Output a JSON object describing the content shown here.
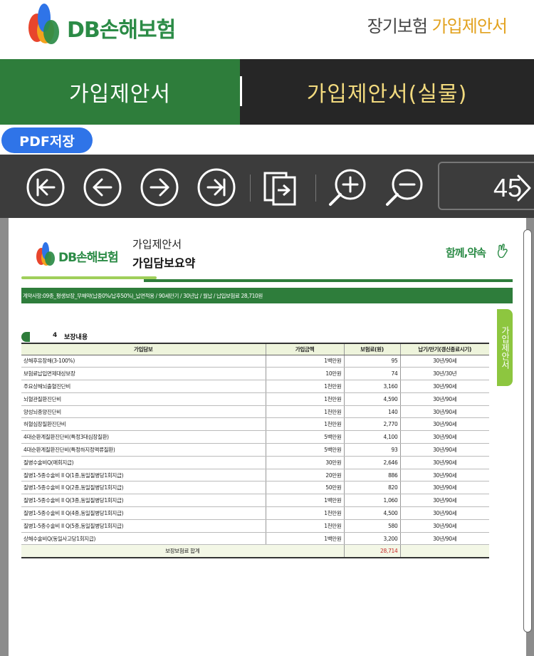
{
  "header": {
    "logo_text": "DB손해보험",
    "title_prefix": "장기보험",
    "title_accent": "가입제안서",
    "brand_green": "#2b8b46",
    "accent_color": "#e2a21f"
  },
  "tabs": [
    {
      "label": "가입제안서",
      "active": true
    },
    {
      "label": "가입제안서(실물)",
      "active": false
    }
  ],
  "pdf_button": {
    "label": "PDF저장"
  },
  "toolbar": {
    "icons": [
      "first-page-icon",
      "prev-page-icon",
      "next-page-icon",
      "last-page-icon",
      "page-view-icon",
      "zoom-in-icon",
      "zoom-out-icon"
    ],
    "page_number": "45"
  },
  "document": {
    "logo_text": "DB손해보험",
    "title1": "가입제안서",
    "title2": "가입담보요약",
    "slogan": "함께,약속",
    "info_bar": "계약사항:09종_평생보장_무해약(납중0%/납후50%)_납면적용 / 90세만기 / 30년납 / 월납 / 납입보험료 28,710원",
    "side_tab": "가입제안서",
    "section_num": "4",
    "section_title": "보장내용",
    "table": {
      "headers": [
        "가입담보",
        "가입금액",
        "보험료(원)",
        "납기/만기(갱신종료시기)"
      ],
      "rows": [
        {
          "name": "상해후유장해(3-100%)",
          "amount": "1백만원",
          "premium": "95",
          "term": "30년/90세"
        },
        {
          "name": "보험료납입면제대상보장",
          "amount": "10만원",
          "premium": "74",
          "term": "30년/30년"
        },
        {
          "name": "주요상해뇌출혈진단비",
          "amount": "1천만원",
          "premium": "3,160",
          "term": "30년/90세"
        },
        {
          "name": "뇌혈관질환진단비",
          "amount": "1천만원",
          "premium": "4,590",
          "term": "30년/90세"
        },
        {
          "name": "양성뇌종양진단비",
          "amount": "1천만원",
          "premium": "140",
          "term": "30년/90세"
        },
        {
          "name": "허혈심장질환진단비",
          "amount": "1천만원",
          "premium": "2,770",
          "term": "30년/90세"
        },
        {
          "name": "4대순환계질환진단비(특정3대심장질환)",
          "amount": "5백만원",
          "premium": "4,100",
          "term": "30년/90세"
        },
        {
          "name": "4대순환계질환진단비(특정하지정맥류질환)",
          "amount": "5백만원",
          "premium": "93",
          "term": "30년/90세"
        },
        {
          "name": "질병수술비Q(매회지급)",
          "amount": "30만원",
          "premium": "2,646",
          "term": "30년/90세"
        },
        {
          "name": "질병1-5종수술비 II Q(1종,동일질병당1회지급)",
          "amount": "20만원",
          "premium": "886",
          "term": "30년/90세"
        },
        {
          "name": "질병1-5종수술비 II Q(2종,동일질병당1회지급)",
          "amount": "50만원",
          "premium": "820",
          "term": "30년/90세"
        },
        {
          "name": "질병1-5종수술비 II Q(3종,동일질병당1회지급)",
          "amount": "1백만원",
          "premium": "1,060",
          "term": "30년/90세"
        },
        {
          "name": "질병1-5종수술비 II Q(4종,동일질병당1회지급)",
          "amount": "1천만원",
          "premium": "4,500",
          "term": "30년/90세"
        },
        {
          "name": "질병1-5종수술비 II Q(5종,동일질병당1회지급)",
          "amount": "1천만원",
          "premium": "580",
          "term": "30년/90세"
        },
        {
          "name": "상해수술비Q(동일사고당1회지급)",
          "amount": "1백만원",
          "premium": "3,200",
          "term": "30년/90세"
        }
      ],
      "total_label": "보장보험료 합계",
      "total_value": "28,714",
      "total_color": "#c62828"
    }
  }
}
